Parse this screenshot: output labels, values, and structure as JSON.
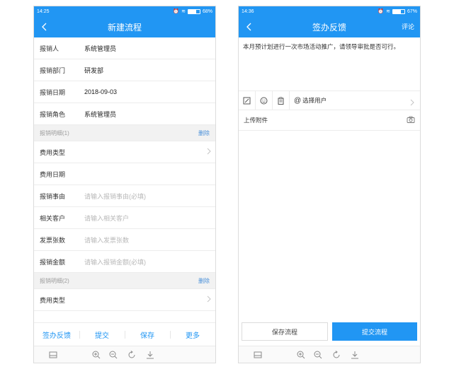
{
  "left": {
    "status": {
      "time": "14:25",
      "battery": "68%",
      "battery_level": 0.68
    },
    "header": {
      "title": "新建流程"
    },
    "fields": [
      {
        "label": "报销人",
        "value": "系统管理员"
      },
      {
        "label": "报销部门",
        "value": "研发部"
      },
      {
        "label": "报销日期",
        "value": "2018-09-03"
      },
      {
        "label": "报销角色",
        "value": "系统管理员"
      }
    ],
    "section1": {
      "title": "报销明细(1)",
      "delete": "删除"
    },
    "detail1": {
      "fee_type": "费用类型",
      "fee_date": "费用日期",
      "reason_label": "报销事由",
      "reason_placeholder": "请输入报销事由(必填)",
      "customer_label": "相关客户",
      "customer_placeholder": "请输入相关客户",
      "invoice_label": "发票张数",
      "invoice_placeholder": "请输入发票张数",
      "amount_label": "报销金额",
      "amount_placeholder": "请输入报销金额(必填)"
    },
    "section2": {
      "title": "报销明细(2)",
      "delete": "删除"
    },
    "detail2": {
      "fee_type": "费用类型"
    },
    "actions": {
      "feedback": "签办反馈",
      "submit": "提交",
      "save": "保存",
      "more": "更多"
    }
  },
  "right": {
    "status": {
      "time": "14:36",
      "battery": "67%",
      "battery_level": 0.67
    },
    "header": {
      "title": "签办反馈",
      "comment": "评论"
    },
    "message": "本月预计划进行一次市场活动推广，请领导审批是否可行。",
    "select_user": "选择用户",
    "attach": "上传附件",
    "buttons": {
      "save": "保存流程",
      "submit": "提交流程"
    }
  },
  "colors": {
    "primary": "#2196f3",
    "link": "#4a90d9"
  },
  "icons": [
    "back-arrow-icon",
    "chevron-right-icon",
    "edit-icon",
    "emoji-icon",
    "clipboard-icon",
    "at-icon",
    "camera-icon",
    "tray-icon",
    "zoom-in-icon",
    "zoom-out-icon",
    "rotate-icon",
    "download-icon"
  ]
}
